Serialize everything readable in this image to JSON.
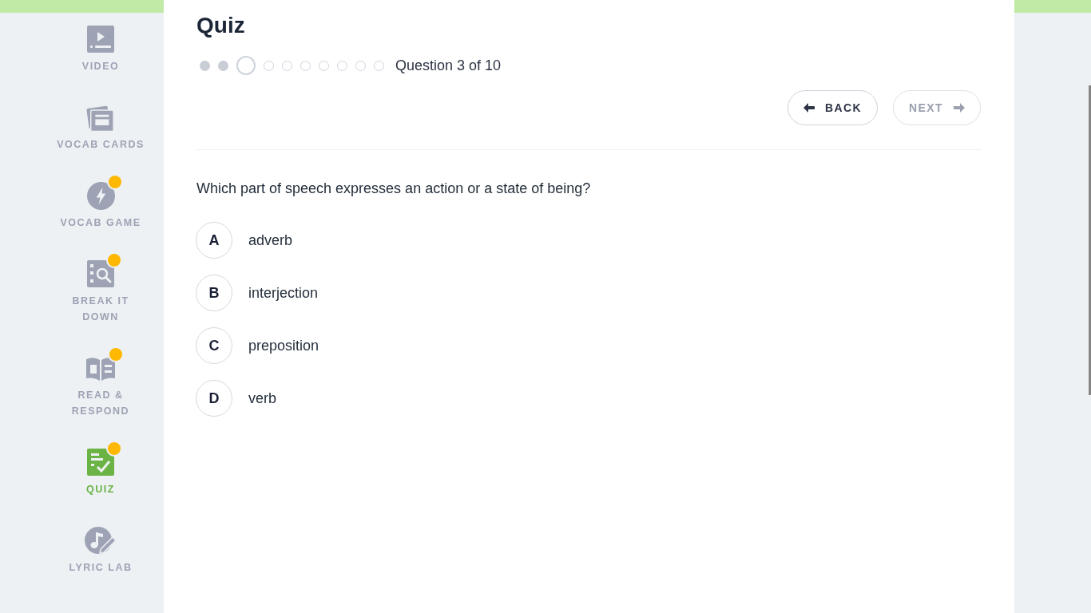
{
  "sidebar": {
    "items": [
      {
        "label": "VIDEO",
        "selected": false,
        "badge": false
      },
      {
        "label": "VOCAB CARDS",
        "selected": false,
        "badge": false
      },
      {
        "label": "VOCAB GAME",
        "selected": false,
        "badge": true
      },
      {
        "label": "BREAK IT DOWN",
        "selected": false,
        "badge": true
      },
      {
        "label": "READ & RESPOND",
        "selected": false,
        "badge": true
      },
      {
        "label": "QUIZ",
        "selected": true,
        "badge": true
      },
      {
        "label": "LYRIC LAB",
        "selected": false,
        "badge": false
      }
    ]
  },
  "quiz": {
    "title": "Quiz",
    "progress": {
      "steps": [
        {
          "completed": true,
          "selected": false
        },
        {
          "completed": true,
          "selected": false
        },
        {
          "completed": false,
          "selected": true
        },
        {
          "completed": false,
          "selected": false
        },
        {
          "completed": false,
          "selected": false
        },
        {
          "completed": false,
          "selected": false
        },
        {
          "completed": false,
          "selected": false
        },
        {
          "completed": false,
          "selected": false
        },
        {
          "completed": false,
          "selected": false
        },
        {
          "completed": false,
          "selected": false
        }
      ],
      "label": "Question 3 of 10"
    },
    "buttons": [
      {
        "kind": "back",
        "label": "BACK",
        "disabled": false
      },
      {
        "kind": "next",
        "label": "NEXT",
        "disabled": true
      }
    ],
    "question": "Which part of speech expresses an action or a state of being?",
    "options": [
      {
        "letter": "A",
        "text": "adverb",
        "selected": false
      },
      {
        "letter": "B",
        "text": "interjection",
        "selected": false
      },
      {
        "letter": "C",
        "text": "preposition",
        "selected": false
      },
      {
        "letter": "D",
        "text": "verb",
        "selected": false
      }
    ]
  }
}
